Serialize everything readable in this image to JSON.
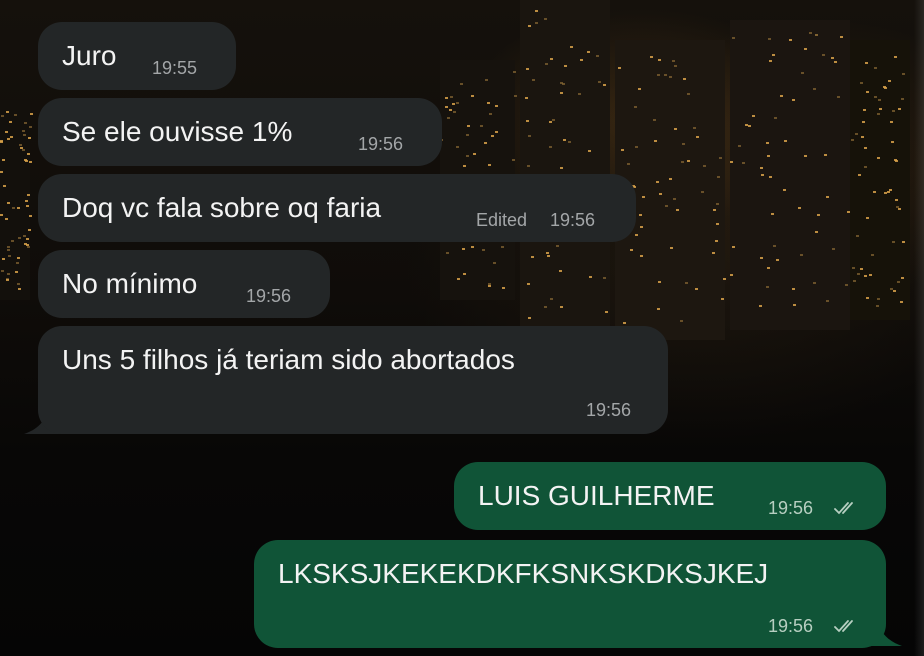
{
  "messages": [
    {
      "direction": "incoming",
      "text": "Juro",
      "time": "19:55",
      "edited": ""
    },
    {
      "direction": "incoming",
      "text": "Se ele ouvisse 1%",
      "time": "19:56",
      "edited": ""
    },
    {
      "direction": "incoming",
      "text": "Doq vc fala sobre oq faria",
      "time": "19:56",
      "edited": "Edited"
    },
    {
      "direction": "incoming",
      "text": "No mínimo",
      "time": "19:56",
      "edited": ""
    },
    {
      "direction": "incoming",
      "text": "Uns 5 filhos já teriam sido abortados",
      "time": "19:56",
      "edited": ""
    },
    {
      "direction": "outgoing",
      "text": "LUIS GUILHERME",
      "time": "19:56",
      "status": "read-double-check"
    },
    {
      "direction": "outgoing",
      "text": "LKSKSJKEKEKDKFKSNKSKDKSJKEJ",
      "time": "19:56",
      "status": "read-double-check"
    }
  ],
  "colors": {
    "incoming_bubble": "#232627",
    "outgoing_bubble": "#105437",
    "timestamp": "#a3a6a8"
  },
  "icons": {
    "read_status": "double-check-icon"
  }
}
